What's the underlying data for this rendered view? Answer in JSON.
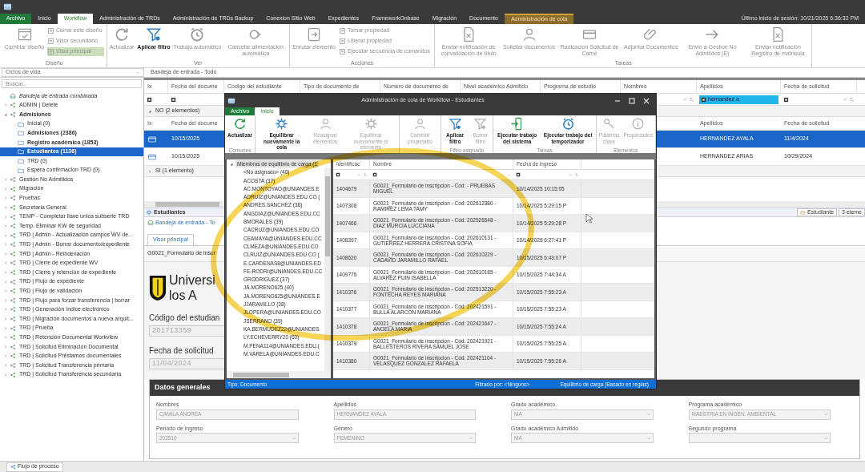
{
  "window": {
    "last_login": "Último inicio de sesión: 10/21/2025 6:36:32 PM"
  },
  "menu_tabs": [
    {
      "label": "Archivo",
      "kind": "file",
      "selected": false
    },
    {
      "label": "Inicio",
      "kind": "tab",
      "selected": false
    },
    {
      "label": "Workflow",
      "kind": "tab",
      "selected": true
    },
    {
      "label": "Administración de TRDs",
      "kind": "tab",
      "selected": false
    },
    {
      "label": "Administración de TRDs Backup",
      "kind": "tab",
      "selected": false
    },
    {
      "label": "Conexion Sitio Web",
      "kind": "tab",
      "selected": false
    },
    {
      "label": "Expedientes",
      "kind": "tab",
      "selected": false
    },
    {
      "label": "FrameworkOnbase",
      "kind": "tab",
      "selected": false
    },
    {
      "label": "Migración",
      "kind": "tab",
      "selected": false
    },
    {
      "label": "Documento",
      "kind": "tab",
      "selected": false
    },
    {
      "label": "Administración de cola",
      "kind": "contextual",
      "selected": false
    }
  ],
  "ribbon_groups": [
    {
      "label": "Diseño",
      "items": [
        {
          "label": "Cambiar diseño",
          "kind": "large",
          "disabled": true,
          "selected": false
        },
        {
          "label": "Cerrar este diseño",
          "kind": "small",
          "disabled": true,
          "selected": false
        },
        {
          "label": "Visor secundario",
          "kind": "small",
          "disabled": true,
          "selected": false
        },
        {
          "label": "Visor principal",
          "kind": "small",
          "disabled": true,
          "selected": true
        }
      ]
    },
    {
      "label": "Ver",
      "items": [
        {
          "label": "Actualizar",
          "kind": "large",
          "disabled": true,
          "selected": false
        },
        {
          "label": "Aplicar filtro",
          "kind": "large",
          "disabled": false,
          "selected": false
        },
        {
          "label": "Trabajo automático",
          "kind": "large",
          "disabled": true,
          "selected": false
        },
        {
          "label": "Cancelar alimentación automática",
          "kind": "large",
          "disabled": true,
          "selected": false
        }
      ]
    },
    {
      "label": "Acciones",
      "items": [
        {
          "label": "Enrutar elemento",
          "kind": "large",
          "disabled": true,
          "selected": false
        },
        {
          "label": "Tomar propiedad",
          "kind": "small",
          "disabled": true,
          "selected": false
        },
        {
          "label": "Liberar propiedad",
          "kind": "small",
          "disabled": true,
          "selected": false
        },
        {
          "label": "Ejecutar secuencia de comandos",
          "kind": "small",
          "disabled": true,
          "selected": false
        }
      ]
    },
    {
      "label": "Tareas",
      "items": [
        {
          "label": "Enviar notificación de convalidación de título",
          "kind": "large",
          "disabled": true,
          "selected": false
        },
        {
          "label": "Solicitar documentos",
          "kind": "large",
          "disabled": true,
          "selected": false
        },
        {
          "label": "Radicacion Solicitud de Carné",
          "kind": "large",
          "disabled": true,
          "selected": false
        },
        {
          "label": "Adjuntar Documentos",
          "kind": "large",
          "disabled": true,
          "selected": false
        },
        {
          "label": "Envio a Gestion No Admitidos (E)",
          "kind": "large",
          "disabled": true,
          "selected": false
        },
        {
          "label": "Enviar notificación Registro de matrícula",
          "kind": "large",
          "disabled": true,
          "selected": false
        }
      ]
    }
  ],
  "sidebar": {
    "lifecycle_select": "Ciclos de vida",
    "search": {
      "placeholder": "Buscar..."
    },
    "tree": [
      {
        "label": "Bandeja de entrada combinada",
        "kind": "inbox",
        "selected": false,
        "emphasized": false
      },
      {
        "label": "ADMIN | Delete",
        "kind": "process",
        "expanded": false,
        "selected": false,
        "emphasized": false
      },
      {
        "label": "Admisiones",
        "kind": "process",
        "expanded": true,
        "selected": false,
        "emphasized": true,
        "children": [
          {
            "label": "Inicial (0)",
            "kind": "queue",
            "selected": false,
            "emphasized": false
          },
          {
            "label": "Admisiones (2386)",
            "kind": "queue",
            "selected": false,
            "emphasized": true
          },
          {
            "label": "Registro académico (1853)",
            "kind": "queue",
            "selected": false,
            "emphasized": true
          },
          {
            "label": "Estudiantes (1136)",
            "kind": "queue",
            "selected": true,
            "emphasized": true
          },
          {
            "label": "TRD (0)",
            "kind": "queue",
            "selected": false,
            "emphasized": false
          },
          {
            "label": "Espera confirmación TRD (0)",
            "kind": "queue",
            "selected": false,
            "emphasized": false
          }
        ]
      },
      {
        "label": "Gestión No Admitidos",
        "kind": "process",
        "expanded": false,
        "selected": false,
        "emphasized": false
      },
      {
        "label": "Migración",
        "kind": "process",
        "expanded": false,
        "selected": false,
        "emphasized": false
      },
      {
        "label": "Pruebas",
        "kind": "process",
        "expanded": false,
        "selected": false,
        "emphasized": false
      },
      {
        "label": "Secretaria General",
        "kind": "process",
        "expanded": false,
        "selected": false,
        "emphasized": false
      },
      {
        "label": "TEMP - Completar llave única subserie TRD",
        "kind": "process",
        "expanded": false,
        "selected": false,
        "emphasized": false
      },
      {
        "label": "Temp. Eliminar KW de seguridad",
        "kind": "process",
        "expanded": false,
        "selected": false,
        "emphasized": false
      },
      {
        "label": "TRD | Admin - Actualización campos WV de...",
        "kind": "process",
        "expanded": false,
        "selected": false,
        "emphasized": false
      },
      {
        "label": "TRD | Admin - Borrar documento/expediente",
        "kind": "process",
        "expanded": false,
        "selected": false,
        "emphasized": false
      },
      {
        "label": "TRD | Admin - Reindexación",
        "kind": "process",
        "expanded": false,
        "selected": false,
        "emphasized": false
      },
      {
        "label": "TRD | Cierre de expediente WV",
        "kind": "process",
        "expanded": false,
        "selected": false,
        "emphasized": false
      },
      {
        "label": "TRD | Cierre y retención de expediente",
        "kind": "process",
        "expanded": false,
        "selected": false,
        "emphasized": false
      },
      {
        "label": "TRD | Flujo de expediente",
        "kind": "process",
        "expanded": false,
        "selected": false,
        "emphasized": false
      },
      {
        "label": "TRD | Flujo de validación",
        "kind": "process",
        "expanded": false,
        "selected": false,
        "emphasized": false
      },
      {
        "label": "TRD | Flujo para forzar transferencia | borrar",
        "kind": "process",
        "expanded": false,
        "selected": false,
        "emphasized": false
      },
      {
        "label": "TRD | Generación índice electrónico",
        "kind": "process",
        "expanded": false,
        "selected": false,
        "emphasized": false
      },
      {
        "label": "TRD | Migración documentos a nueva arquit...",
        "kind": "process",
        "expanded": false,
        "selected": false,
        "emphasized": false
      },
      {
        "label": "TRD | Prueba",
        "kind": "process",
        "expanded": false,
        "selected": false,
        "emphasized": false
      },
      {
        "label": "TRD | Retención Documental Workview",
        "kind": "process",
        "expanded": false,
        "selected": false,
        "emphasized": false
      },
      {
        "label": "TRD | Solicitud Eliminación Documental",
        "kind": "process",
        "expanded": false,
        "selected": false,
        "emphasized": false
      },
      {
        "label": "TRD | Solicitud Préstamos documentales",
        "kind": "process",
        "expanded": false,
        "selected": false,
        "emphasized": false
      },
      {
        "label": "TRD | Solicitud Transferencia primaria",
        "kind": "process",
        "expanded": false,
        "selected": false,
        "emphasized": false
      },
      {
        "label": "TRD | Solicitud Transferencia secundaria",
        "kind": "process",
        "expanded": false,
        "selected": false,
        "emphasized": false
      }
    ]
  },
  "inbox": {
    "title": "Bandeja de entrada - Todo",
    "columns": [
      "Ix",
      "Fecha del docume",
      "Código del estudiante",
      "Tipo de documento de",
      "Número de documento de",
      "Nivel académico Admitido",
      "Programa de estudio",
      "Nombres",
      "Apellidos",
      "Fecha de solicitud"
    ],
    "filters": {
      "left": [
        {
          "kind": "checkbox"
        },
        {
          "kind": "checkbox"
        }
      ],
      "right": [
        {
          "kind": "caret"
        },
        {
          "kind": "text",
          "value": "hernandez a"
        },
        {
          "kind": "dropdown"
        }
      ]
    },
    "groups": [
      {
        "label": "NO (2 elementos)",
        "expanded": true,
        "header_left": [
          "Ix",
          "Fecha del docume"
        ],
        "header_right": [
          "Apellidos",
          "Fecha de solicitud"
        ],
        "rows": [
          {
            "selected": true,
            "cells_left": [
              "10/15/2025"
            ],
            "cells_right": [
              "HERNANDEZ AYALA",
              "11/4/2024"
            ]
          },
          {
            "selected": false,
            "cells_left": [
              "10/15/2025"
            ],
            "cells_right": [
              "HERNANDEZ ARIAS",
              "10/29/2024"
            ]
          }
        ]
      },
      {
        "label": "SI (1 elemento)",
        "expanded": false
      }
    ]
  },
  "detail": {
    "pane_title": "Estudiantes",
    "breadcrumb": "Bandeja de entrada - To",
    "type_button": "Estudiante",
    "count": "3 eleme",
    "viewer_tab": {
      "label": "Visor principal",
      "selected": true
    },
    "document_title": "G0021_Formulario de inscr",
    "logo_lines": [
      "Universi",
      "los A"
    ],
    "fields": [
      {
        "label": "Código del estudian",
        "value": "201713359"
      },
      {
        "label": "Fecha de solicitud",
        "value": "11/04/2024"
      }
    ],
    "section_title": "Datos generales",
    "form": [
      {
        "label": "Nombres",
        "value": "CAMILA ANDREA",
        "kind": "text"
      },
      {
        "label": "Apellidos",
        "value": "HERNANDEZ AYALA",
        "kind": "text"
      },
      {
        "label": "Grado académico",
        "value": "MA",
        "kind": "select"
      },
      {
        "label": "Programa académico",
        "value": "MAESTRIA EN INGEN. AMBIENTAL",
        "kind": "select"
      },
      {
        "label": "Periodo de ingreso",
        "value": "202510",
        "kind": "select"
      },
      {
        "label": "Género",
        "value": "FEMENINO",
        "kind": "select"
      },
      {
        "label": "Grado académico Admitido",
        "value": "MA",
        "kind": "select"
      },
      {
        "label": "Segundo programa",
        "kind": "select"
      }
    ]
  },
  "bottom_tab": "Flujo de proceso",
  "dialog": {
    "title": "Administración de cola de Workflow - Estudiantes",
    "tabs": [
      {
        "label": "Archivo",
        "kind": "file",
        "selected": false
      },
      {
        "label": "Inicio",
        "kind": "tab",
        "selected": true
      }
    ],
    "ribbon_groups": [
      {
        "label": "Comunes",
        "items": [
          {
            "label": "Actualizar",
            "disabled": false
          }
        ]
      },
      {
        "items": [
          {
            "label": "Equilibrar nuevamente la cola",
            "disabled": false
          },
          {
            "label": "Reasignar elementos",
            "disabled": true
          },
          {
            "label": "Equilibrar nuevamente el elemento",
            "disabled": true
          }
        ]
      },
      {
        "items": [
          {
            "label": "Cambiar propietario",
            "disabled": true
          }
        ]
      },
      {
        "label": "Filtro asignado",
        "items": [
          {
            "label": "Aplicar filtro",
            "disabled": false
          },
          {
            "label": "Borrar filtro",
            "disabled": true
          }
        ]
      },
      {
        "label": "Tareas",
        "items": [
          {
            "label": "Ejecutar trabajo del sistema",
            "disabled": false
          },
          {
            "label": "Ejecutar trabajo del temporizador",
            "disabled": false
          }
        ]
      },
      {
        "label": "Elementos",
        "items": [
          {
            "label": "Palabras clave",
            "disabled": true
          },
          {
            "label": "Propiedades",
            "disabled": true
          }
        ]
      }
    ],
    "members": {
      "label": "Miembros de equilibrio de carga (1",
      "expanded": true,
      "selected": true,
      "children": [
        {
          "label": "<No asignado> (40)",
          "selected": false
        },
        {
          "label": "ACOSTA (37)",
          "selected": false
        },
        {
          "label": "AC.MONTOYAO@UNIANDES.E",
          "selected": false
        },
        {
          "label": "ADRUIZ@UNIANDES.EDU.CO (",
          "selected": false
        },
        {
          "label": "ANDRES.SANCHEZ (38)",
          "selected": false
        },
        {
          "label": "ANGDIAZ@UNIANDES.EDU.CC",
          "selected": false
        },
        {
          "label": "BMORALES (39)",
          "selected": false
        },
        {
          "label": "CACRUZ@UNIANDES.EDU.CO",
          "selected": false
        },
        {
          "label": "CEAMAYA@UNIANDES.EDU.CC",
          "selected": false
        },
        {
          "label": "CLMEZA@UNIANDES.EDU.CO",
          "selected": false
        },
        {
          "label": "CLRUIZ@UNIANDES.EDU.CO (",
          "selected": false
        },
        {
          "label": "E.CARDENAS8@UNIANDES.ED",
          "selected": false
        },
        {
          "label": "FE-RODRI@UNIANDES.EDU.CC",
          "selected": false
        },
        {
          "label": "GRODRIGUEZ (37)",
          "selected": false
        },
        {
          "label": "JA.MORENO625 (40)",
          "selected": false
        },
        {
          "label": "JA.MORENO625@UNIANDES.E",
          "selected": false
        },
        {
          "label": "JJARAMILLO (38)",
          "selected": false
        },
        {
          "label": "JLOPERA@UNIANDES.EDU.CO",
          "selected": false
        },
        {
          "label": "JSERRANO (39)",
          "selected": false
        },
        {
          "label": "KA.BERMUDEZ22@UNIANDES.",
          "selected": false
        },
        {
          "label": "LY.ECHEVERRY20 (60)",
          "selected": false
        },
        {
          "label": "M.PENA114@UNIANDES.EDU.(",
          "selected": false
        },
        {
          "label": "M.VARELA@UNIANDES.EDU.C",
          "selected": false
        }
      ]
    },
    "columns": [
      "Identificac",
      "Nombre",
      "Fecha de ingreso"
    ],
    "rows": [
      [
        "1404679",
        "G0021_Formulario de inscripcion - Cód:  - PRUEBAS MIGUEL",
        "10/14/2025 10:15:05"
      ],
      [
        "1407308",
        "G0021_Formulario de inscripcion - Cód: 202612380 - RAMIREZ LEMA TAMY",
        "10/14/2025 5:29:15 P"
      ],
      [
        "1407466",
        "G0021_Formulario de inscripcion - Cód: 202526548 - DIAZ MURCIA LUCCIANA",
        "10/14/2025 5:29:28 P"
      ],
      [
        "1408397",
        "G0021_Formulario de inscripcion - Cód: 202610131 - GUTIERREZ HERRERA CRISTINA SOFIA",
        "10/14/2025 6:27:41 P"
      ],
      [
        "1408620",
        "G0021_Formulario de inscripcion - Cód: 202610229 - CADAVID JARAMILLO RAFAEL",
        "10/15/2025 6:43:07 P"
      ],
      [
        "1409775",
        "G0021_Formulario de inscripcion - Cód: 202610185 - ALVAREZ PUIN ISABELLA",
        "10/15/2025 7:44:34 A"
      ],
      [
        "1410376",
        "G0021_Formulario de inscripcion - Cód: 202513220 - FONTECHA REYES MARIANA",
        "10/15/2025 7:55:23 A"
      ],
      [
        "1410377",
        "G0021_Formulario de inscripcion - Cód: 202421591 - BULLA ALARCON MARIANA",
        "10/15/2025 7:55:23 A"
      ],
      [
        "1410378",
        "G0021_Formulario de inscripcion - Cód: 202421647 - ANGELA MARIA",
        "10/15/2025 7:55:24 A"
      ],
      [
        "1410379",
        "G0021_Formulario de inscripcion - Cód: 202421921 - BALLESTEROS RIVERA SAMUEL JOSE",
        "10/15/2025 7:55:25 A"
      ],
      [
        "1410380",
        "G0021_Formulario de inscripcion - Cód: 202421104 - VELASQUEZ GONZALEZ RAFAELA",
        "10/15/2025 7:55:26 A"
      ]
    ],
    "status": {
      "type": "Tipo: Documento",
      "filter": "Filtrado por: <Ninguno>",
      "balance": "Equilibrio de carga (Basado en reglas)"
    }
  }
}
